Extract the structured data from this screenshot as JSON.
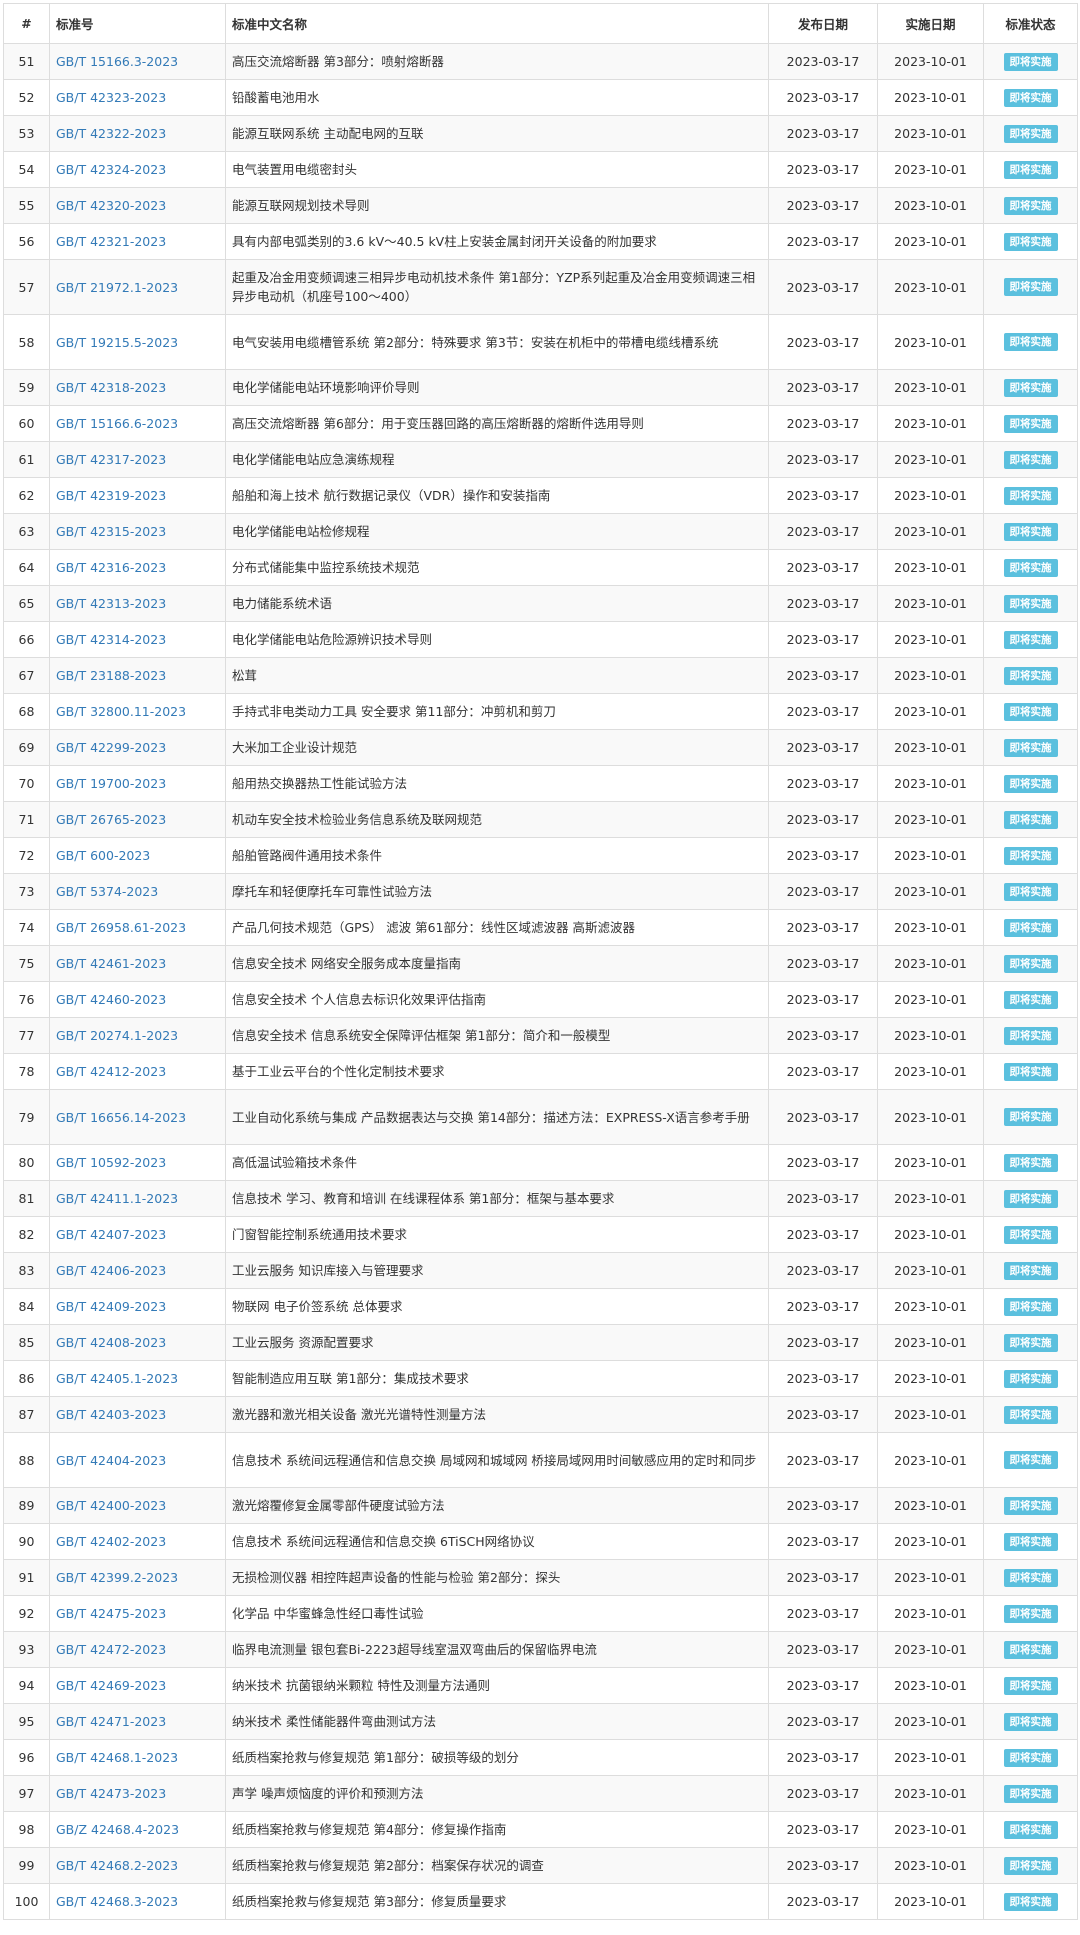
{
  "table": {
    "headers": {
      "num": "#",
      "code": "标准号",
      "name": "标准中文名称",
      "published": "发布日期",
      "implemented": "实施日期",
      "status": "标准状态"
    },
    "status_label": "即将实施",
    "rows": [
      {
        "num": "51",
        "code": "GB/T 15166.3-2023",
        "name": "高压交流熔断器 第3部分：喷射熔断器",
        "pub": "2023-03-17",
        "impl": "2023-10-01"
      },
      {
        "num": "52",
        "code": "GB/T 42323-2023",
        "name": "铅酸蓄电池用水",
        "pub": "2023-03-17",
        "impl": "2023-10-01"
      },
      {
        "num": "53",
        "code": "GB/T 42322-2023",
        "name": "能源互联网系统 主动配电网的互联",
        "pub": "2023-03-17",
        "impl": "2023-10-01"
      },
      {
        "num": "54",
        "code": "GB/T 42324-2023",
        "name": "电气装置用电缆密封头",
        "pub": "2023-03-17",
        "impl": "2023-10-01"
      },
      {
        "num": "55",
        "code": "GB/T 42320-2023",
        "name": "能源互联网规划技术导则",
        "pub": "2023-03-17",
        "impl": "2023-10-01"
      },
      {
        "num": "56",
        "code": "GB/T 42321-2023",
        "name": "具有内部电弧类别的3.6 kV～40.5 kV柱上安装金属封闭开关设备的附加要求",
        "pub": "2023-03-17",
        "impl": "2023-10-01"
      },
      {
        "num": "57",
        "code": "GB/T 21972.1-2023",
        "name": "起重及冶金用变频调速三相异步电动机技术条件 第1部分：YZP系列起重及冶金用变频调速三相异步电动机（机座号100～400）",
        "pub": "2023-03-17",
        "impl": "2023-10-01"
      },
      {
        "num": "58",
        "code": "GB/T 19215.5-2023",
        "name": "电气安装用电缆槽管系统 第2部分：特殊要求 第3节：安装在机柜中的带槽电缆线槽系统",
        "pub": "2023-03-17",
        "impl": "2023-10-01"
      },
      {
        "num": "59",
        "code": "GB/T 42318-2023",
        "name": "电化学储能电站环境影响评价导则",
        "pub": "2023-03-17",
        "impl": "2023-10-01"
      },
      {
        "num": "60",
        "code": "GB/T 15166.6-2023",
        "name": "高压交流熔断器 第6部分：用于变压器回路的高压熔断器的熔断件选用导则",
        "pub": "2023-03-17",
        "impl": "2023-10-01"
      },
      {
        "num": "61",
        "code": "GB/T 42317-2023",
        "name": "电化学储能电站应急演练规程",
        "pub": "2023-03-17",
        "impl": "2023-10-01"
      },
      {
        "num": "62",
        "code": "GB/T 42319-2023",
        "name": "船舶和海上技术 航行数据记录仪（VDR）操作和安装指南",
        "pub": "2023-03-17",
        "impl": "2023-10-01"
      },
      {
        "num": "63",
        "code": "GB/T 42315-2023",
        "name": "电化学储能电站检修规程",
        "pub": "2023-03-17",
        "impl": "2023-10-01"
      },
      {
        "num": "64",
        "code": "GB/T 42316-2023",
        "name": "分布式储能集中监控系统技术规范",
        "pub": "2023-03-17",
        "impl": "2023-10-01"
      },
      {
        "num": "65",
        "code": "GB/T 42313-2023",
        "name": "电力储能系统术语",
        "pub": "2023-03-17",
        "impl": "2023-10-01"
      },
      {
        "num": "66",
        "code": "GB/T 42314-2023",
        "name": "电化学储能电站危险源辨识技术导则",
        "pub": "2023-03-17",
        "impl": "2023-10-01"
      },
      {
        "num": "67",
        "code": "GB/T 23188-2023",
        "name": "松茸",
        "pub": "2023-03-17",
        "impl": "2023-10-01"
      },
      {
        "num": "68",
        "code": "GB/T 32800.11-2023",
        "name": "手持式非电类动力工具 安全要求 第11部分：冲剪机和剪刀",
        "pub": "2023-03-17",
        "impl": "2023-10-01"
      },
      {
        "num": "69",
        "code": "GB/T 42299-2023",
        "name": "大米加工企业设计规范",
        "pub": "2023-03-17",
        "impl": "2023-10-01"
      },
      {
        "num": "70",
        "code": "GB/T 19700-2023",
        "name": "船用热交换器热工性能试验方法",
        "pub": "2023-03-17",
        "impl": "2023-10-01"
      },
      {
        "num": "71",
        "code": "GB/T 26765-2023",
        "name": "机动车安全技术检验业务信息系统及联网规范",
        "pub": "2023-03-17",
        "impl": "2023-10-01"
      },
      {
        "num": "72",
        "code": "GB/T 600-2023",
        "name": "船舶管路阀件通用技术条件",
        "pub": "2023-03-17",
        "impl": "2023-10-01"
      },
      {
        "num": "73",
        "code": "GB/T 5374-2023",
        "name": "摩托车和轻便摩托车可靠性试验方法",
        "pub": "2023-03-17",
        "impl": "2023-10-01"
      },
      {
        "num": "74",
        "code": "GB/T 26958.61-2023",
        "name": "产品几何技术规范（GPS） 滤波 第61部分：线性区域滤波器 高斯滤波器",
        "pub": "2023-03-17",
        "impl": "2023-10-01"
      },
      {
        "num": "75",
        "code": "GB/T 42461-2023",
        "name": "信息安全技术 网络安全服务成本度量指南",
        "pub": "2023-03-17",
        "impl": "2023-10-01"
      },
      {
        "num": "76",
        "code": "GB/T 42460-2023",
        "name": "信息安全技术 个人信息去标识化效果评估指南",
        "pub": "2023-03-17",
        "impl": "2023-10-01"
      },
      {
        "num": "77",
        "code": "GB/T 20274.1-2023",
        "name": "信息安全技术 信息系统安全保障评估框架 第1部分：简介和一般模型",
        "pub": "2023-03-17",
        "impl": "2023-10-01"
      },
      {
        "num": "78",
        "code": "GB/T 42412-2023",
        "name": "基于工业云平台的个性化定制技术要求",
        "pub": "2023-03-17",
        "impl": "2023-10-01"
      },
      {
        "num": "79",
        "code": "GB/T 16656.14-2023",
        "name": "工业自动化系统与集成 产品数据表达与交换 第14部分：描述方法：EXPRESS-X语言参考手册",
        "pub": "2023-03-17",
        "impl": "2023-10-01"
      },
      {
        "num": "80",
        "code": "GB/T 10592-2023",
        "name": "高低温试验箱技术条件",
        "pub": "2023-03-17",
        "impl": "2023-10-01"
      },
      {
        "num": "81",
        "code": "GB/T 42411.1-2023",
        "name": "信息技术 学习、教育和培训 在线课程体系 第1部分：框架与基本要求",
        "pub": "2023-03-17",
        "impl": "2023-10-01"
      },
      {
        "num": "82",
        "code": "GB/T 42407-2023",
        "name": "门窗智能控制系统通用技术要求",
        "pub": "2023-03-17",
        "impl": "2023-10-01"
      },
      {
        "num": "83",
        "code": "GB/T 42406-2023",
        "name": "工业云服务 知识库接入与管理要求",
        "pub": "2023-03-17",
        "impl": "2023-10-01"
      },
      {
        "num": "84",
        "code": "GB/T 42409-2023",
        "name": "物联网 电子价签系统 总体要求",
        "pub": "2023-03-17",
        "impl": "2023-10-01"
      },
      {
        "num": "85",
        "code": "GB/T 42408-2023",
        "name": "工业云服务 资源配置要求",
        "pub": "2023-03-17",
        "impl": "2023-10-01"
      },
      {
        "num": "86",
        "code": "GB/T 42405.1-2023",
        "name": "智能制造应用互联 第1部分：集成技术要求",
        "pub": "2023-03-17",
        "impl": "2023-10-01"
      },
      {
        "num": "87",
        "code": "GB/T 42403-2023",
        "name": "激光器和激光相关设备 激光光谱特性测量方法",
        "pub": "2023-03-17",
        "impl": "2023-10-01"
      },
      {
        "num": "88",
        "code": "GB/T 42404-2023",
        "name": "信息技术 系统间远程通信和信息交换 局域网和城域网 桥接局域网用时间敏感应用的定时和同步",
        "pub": "2023-03-17",
        "impl": "2023-10-01"
      },
      {
        "num": "89",
        "code": "GB/T 42400-2023",
        "name": "激光熔覆修复金属零部件硬度试验方法",
        "pub": "2023-03-17",
        "impl": "2023-10-01"
      },
      {
        "num": "90",
        "code": "GB/T 42402-2023",
        "name": "信息技术 系统间远程通信和信息交换 6TiSCH网络协议",
        "pub": "2023-03-17",
        "impl": "2023-10-01"
      },
      {
        "num": "91",
        "code": "GB/T 42399.2-2023",
        "name": "无损检测仪器 相控阵超声设备的性能与检验 第2部分：探头",
        "pub": "2023-03-17",
        "impl": "2023-10-01"
      },
      {
        "num": "92",
        "code": "GB/T 42475-2023",
        "name": "化学品 中华蜜蜂急性经口毒性试验",
        "pub": "2023-03-17",
        "impl": "2023-10-01"
      },
      {
        "num": "93",
        "code": "GB/T 42472-2023",
        "name": "临界电流测量 银包套Bi-2223超导线室温双弯曲后的保留临界电流",
        "pub": "2023-03-17",
        "impl": "2023-10-01"
      },
      {
        "num": "94",
        "code": "GB/T 42469-2023",
        "name": "纳米技术 抗菌银纳米颗粒 特性及测量方法通则",
        "pub": "2023-03-17",
        "impl": "2023-10-01"
      },
      {
        "num": "95",
        "code": "GB/T 42471-2023",
        "name": "纳米技术 柔性储能器件弯曲测试方法",
        "pub": "2023-03-17",
        "impl": "2023-10-01"
      },
      {
        "num": "96",
        "code": "GB/T 42468.1-2023",
        "name": "纸质档案抢救与修复规范 第1部分：破损等级的划分",
        "pub": "2023-03-17",
        "impl": "2023-10-01"
      },
      {
        "num": "97",
        "code": "GB/T 42473-2023",
        "name": "声学 噪声烦恼度的评价和预测方法",
        "pub": "2023-03-17",
        "impl": "2023-10-01"
      },
      {
        "num": "98",
        "code": "GB/Z 42468.4-2023",
        "name": "纸质档案抢救与修复规范 第4部分：修复操作指南",
        "pub": "2023-03-17",
        "impl": "2023-10-01"
      },
      {
        "num": "99",
        "code": "GB/T 42468.2-2023",
        "name": "纸质档案抢救与修复规范 第2部分：档案保存状况的调查",
        "pub": "2023-03-17",
        "impl": "2023-10-01"
      },
      {
        "num": "100",
        "code": "GB/T 42468.3-2023",
        "name": "纸质档案抢救与修复规范 第3部分：修复质量要求",
        "pub": "2023-03-17",
        "impl": "2023-10-01"
      }
    ]
  }
}
